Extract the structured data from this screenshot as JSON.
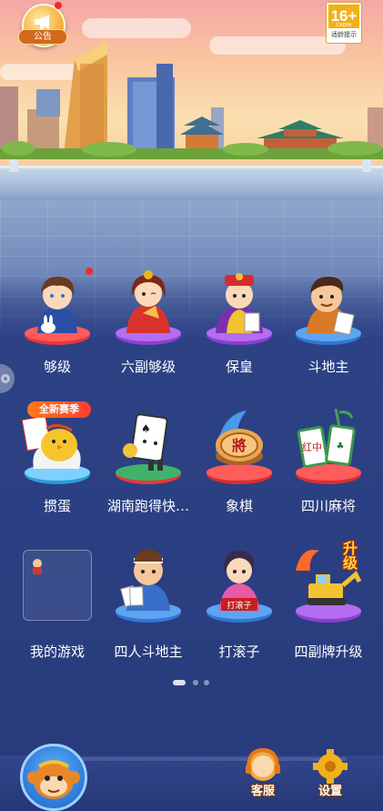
{
  "top": {
    "notice_label": "公告",
    "age_rating": "16+",
    "age_rating_org": "CADPA",
    "age_tip": "适龄提示"
  },
  "games": [
    {
      "label": "够级",
      "icon": "hero-boy-icon",
      "has_badge": true
    },
    {
      "label": "六副够级",
      "icon": "lady-with-fan-icon",
      "has_badge": false
    },
    {
      "label": "保皇",
      "icon": "emperor-icon",
      "has_badge": false
    },
    {
      "label": "斗地主",
      "icon": "landlord-icon",
      "has_badge": false
    },
    {
      "label": "掼蛋",
      "icon": "chick-in-egg-icon",
      "tag": "全新赛季"
    },
    {
      "label": "湖南跑得快…",
      "icon": "playing-card-character-icon"
    },
    {
      "label": "象棋",
      "icon": "chess-piece-icon",
      "piece_text": "將"
    },
    {
      "label": "四川麻将",
      "icon": "mahjong-tiles-icon",
      "tile_text": "红中"
    },
    {
      "label": "我的游戏",
      "icon": "my-games-slot-icon"
    },
    {
      "label": "四人斗地主",
      "icon": "card-player-icon"
    },
    {
      "label": "打滚子",
      "icon": "girl-with-cards-icon",
      "sign_text": "打滚子"
    },
    {
      "label": "四副牌升级",
      "icon": "excavator-upgrade-icon",
      "badge_text": "升级"
    }
  ],
  "pager": {
    "pages": 3,
    "current": 1
  },
  "bottom": {
    "service_label": "客服",
    "settings_label": "设置"
  },
  "colors": {
    "panel": "#2a3e80",
    "accent_orange": "#f3a92e",
    "badge_red": "#ee2b2b"
  }
}
